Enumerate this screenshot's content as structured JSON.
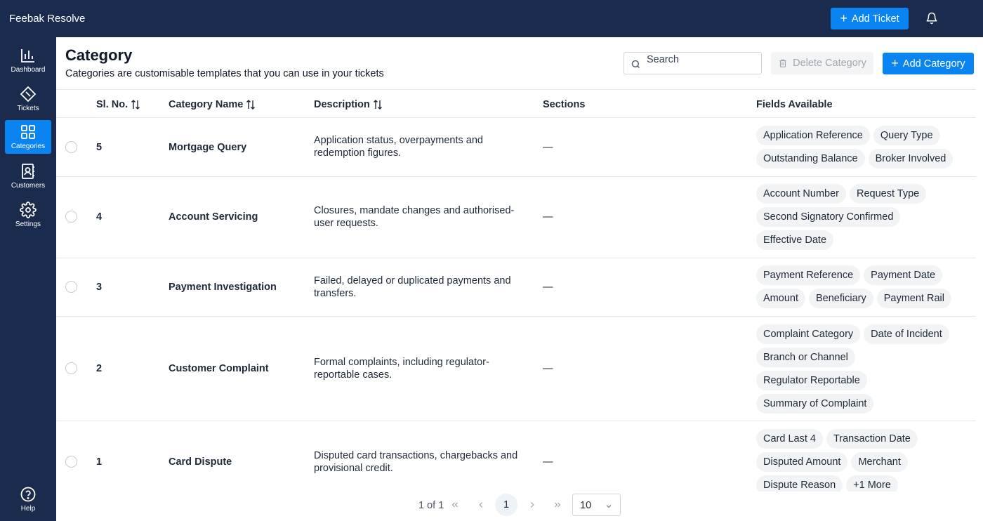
{
  "app": {
    "title": "Feebak Resolve"
  },
  "topbar": {
    "add_ticket_label": "Add Ticket"
  },
  "sidebar": {
    "items": [
      {
        "label": "Dashboard",
        "icon": "bar-chart-icon",
        "active": false
      },
      {
        "label": "Tickets",
        "icon": "ticket-icon",
        "active": false
      },
      {
        "label": "Categories",
        "icon": "grid-icon",
        "active": true
      },
      {
        "label": "Customers",
        "icon": "contact-book-icon",
        "active": false
      },
      {
        "label": "Settings",
        "icon": "gear-icon",
        "active": false
      }
    ],
    "help_label": "Help"
  },
  "page": {
    "title": "Category",
    "subtitle": "Categories are customisable templates that you can use in your tickets"
  },
  "toolbar": {
    "search_placeholder": "Search",
    "delete_label": "Delete Category",
    "add_label": "Add Category"
  },
  "table": {
    "headers": {
      "sl_no": "Sl. No.",
      "name": "Category Name",
      "description": "Description",
      "sections": "Sections",
      "fields": "Fields Available"
    },
    "rows": [
      {
        "sl_no": "5",
        "name": "Mortgage Query",
        "description_lines": [
          "Application status, overpayments and",
          "redemption figures."
        ],
        "sections": "—",
        "fields": [
          [
            "Application Reference",
            "Query Type"
          ],
          [
            "Outstanding Balance",
            "Broker Involved"
          ]
        ]
      },
      {
        "sl_no": "4",
        "name": "Account Servicing",
        "description_lines": [
          "Closures, mandate changes and authorised-",
          "user requests."
        ],
        "sections": "—",
        "fields": [
          [
            "Account Number",
            "Request Type"
          ],
          [
            "Second Signatory Confirmed"
          ],
          [
            "Effective Date"
          ]
        ]
      },
      {
        "sl_no": "3",
        "name": "Payment Investigation",
        "description_lines": [
          "Failed, delayed or duplicated payments and",
          "transfers."
        ],
        "sections": "—",
        "fields": [
          [
            "Payment Reference",
            "Payment Date"
          ],
          [
            "Amount",
            "Beneficiary",
            "Payment Rail"
          ]
        ]
      },
      {
        "sl_no": "2",
        "name": "Customer Complaint",
        "description_lines": [
          "Formal complaints, including regulator-",
          "reportable cases."
        ],
        "sections": "—",
        "fields": [
          [
            "Complaint Category",
            "Date of Incident"
          ],
          [
            "Branch or Channel"
          ],
          [
            "Regulator Reportable"
          ],
          [
            "Summary of Complaint"
          ]
        ]
      },
      {
        "sl_no": "1",
        "name": "Card Dispute",
        "description_lines": [
          "Disputed card transactions, chargebacks and",
          "provisional credit."
        ],
        "sections": "—",
        "fields": [
          [
            "Card Last 4",
            "Transaction Date"
          ],
          [
            "Disputed Amount",
            "Merchant"
          ],
          [
            "Dispute Reason",
            "+1 More"
          ]
        ]
      }
    ]
  },
  "pagination": {
    "summary": "1 of 1",
    "current_page": "1",
    "page_size": "10"
  },
  "colors": {
    "navy": "#1b2b4d",
    "accent": "#0a84f0",
    "chip": "#f1f3f5"
  }
}
